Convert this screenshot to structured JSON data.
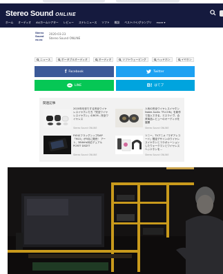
{
  "header": {
    "logo_main": "Stereo Sound",
    "logo_online": "ONLINE",
    "nav": [
      "ホーム",
      "オーディオ",
      "AV/ホームシアター",
      "レビュー",
      "ステレニュース",
      "ソフト",
      "雑誌",
      "ベストバイ/グランプリ",
      "more ▾"
    ]
  },
  "article": {
    "author_logo": [
      "Stereo",
      "Sound",
      "ONLINE"
    ],
    "date": "2020-03-23",
    "author": "Stereo Sound ONLINE",
    "tags": [
      "ニュース",
      "ポータブルオーディオ",
      "オーディオ",
      "ソフトウェービング",
      "ヘッドホン",
      "イヤホン"
    ]
  },
  "share": {
    "facebook": "Facebook",
    "twitter": "Twitter",
    "line": "LINE",
    "hatena": "はてブ"
  },
  "related": {
    "title": "関連記事",
    "items": [
      {
        "text": "2020年を彩りする完全ワイヤレスイヤホンたち「完全ワイヤレスイヤホン」のBCM…完全ワイヤレス",
        "source": "Stereo Sound ONLINE"
      },
      {
        "text": "人気の完全ワイヤレスイヤホン Noble Audio「FLCON」を新作で投入できる、エスライヴ、合資商品レビューのオーディオを展開",
        "source": "Stereo Sound ONLINE"
      },
      {
        "text": "FiiOのフラッグシップDAP「M15」が9月に発売！ アート、384kHz対応デュアルPCM?? DSD??",
        "source": "Stereo Sound ONLINE"
      },
      {
        "text": "ソニー、TVアニメ『マギアレコード』限定デザインのワイヤレスイヤホンとコラボレーションしたウォークマンとワイヤレスヘッドホンを…",
        "source": "Stereo Sound ONLINE"
      }
    ]
  },
  "colors": {
    "header_bg": "#151a3e",
    "facebook": "#3b5998",
    "twitter": "#1da1f2",
    "line": "#06c755",
    "hatena": "#00a4de"
  }
}
